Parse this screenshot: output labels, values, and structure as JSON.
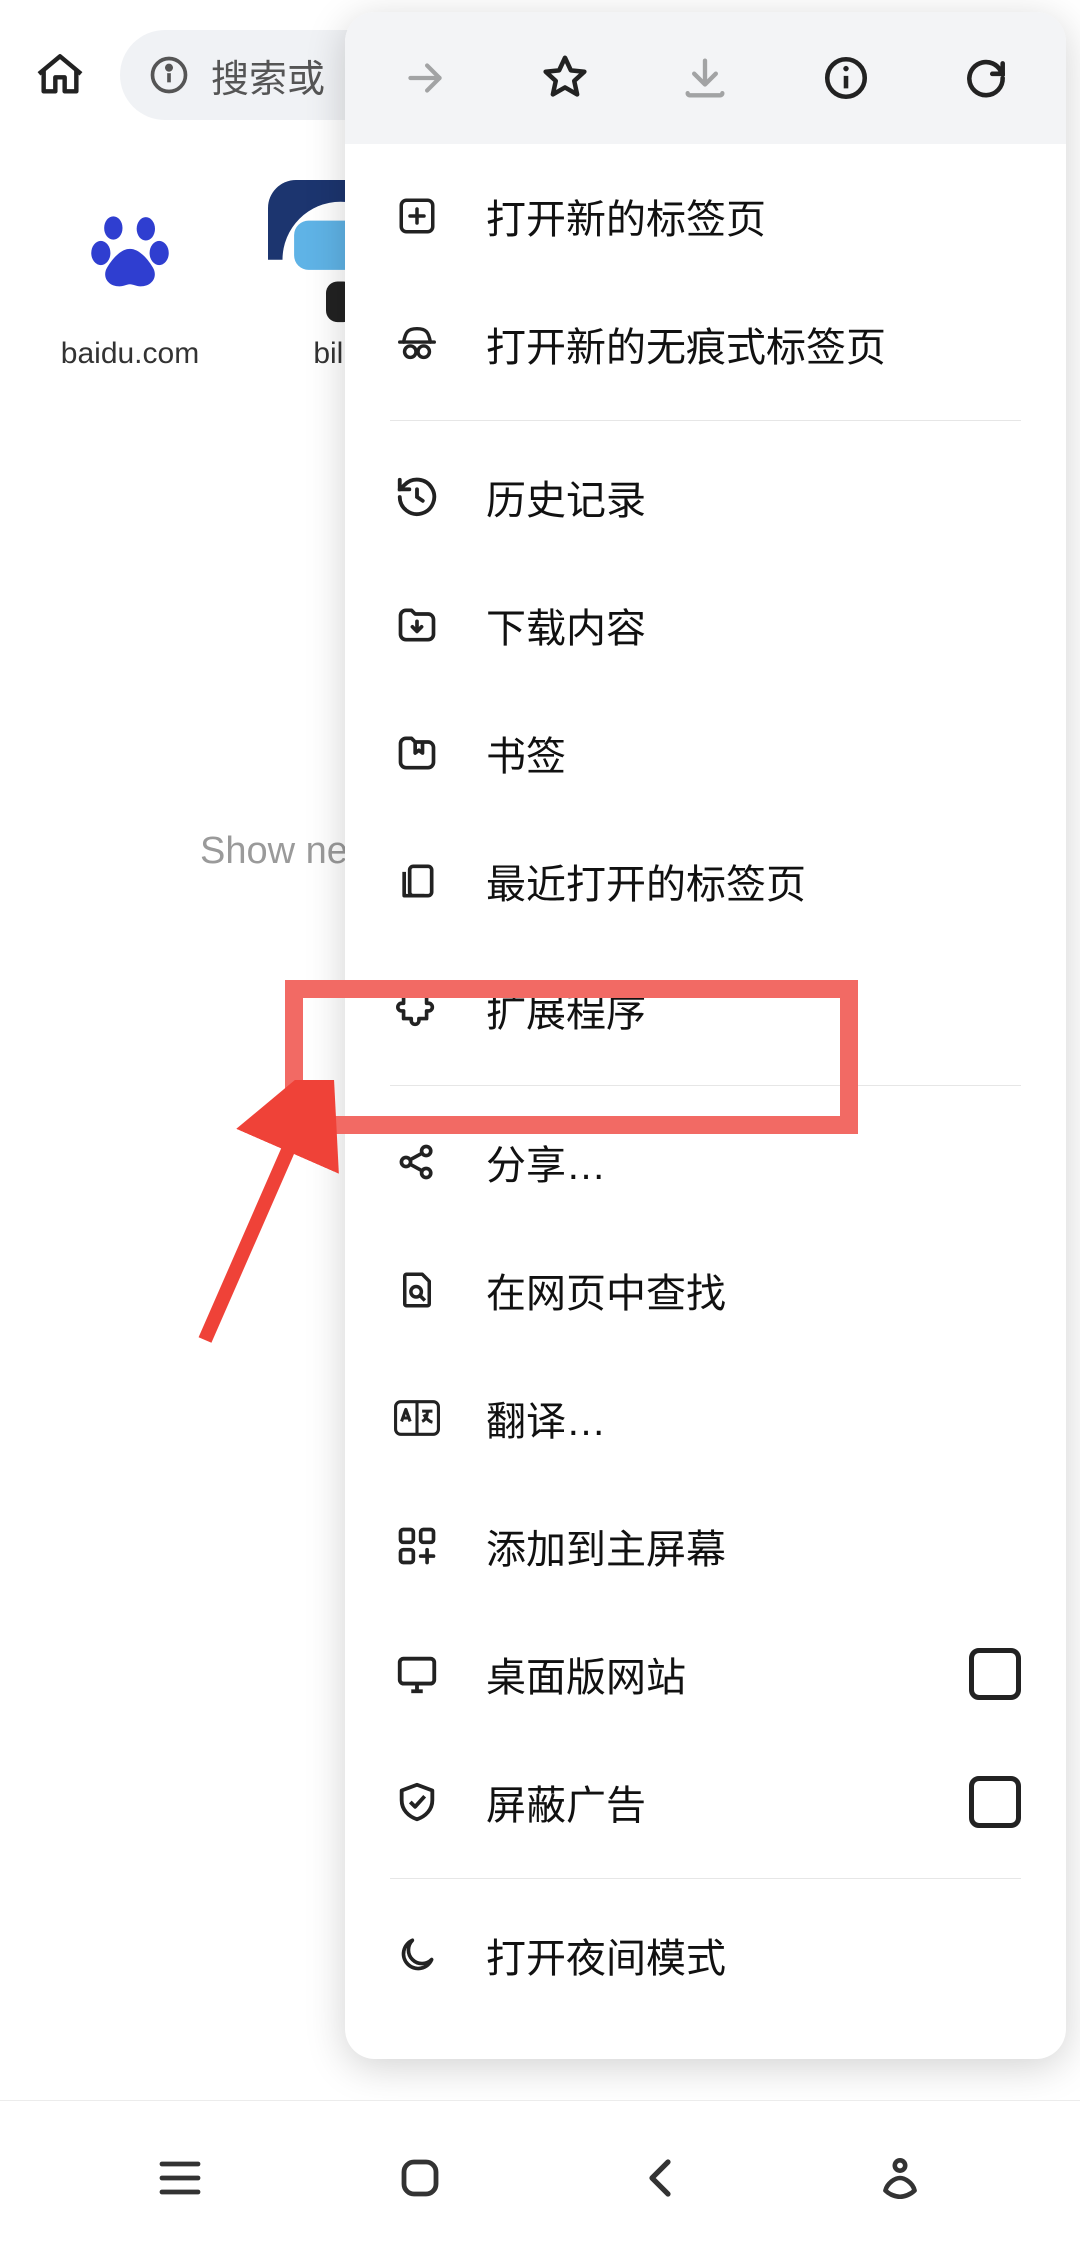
{
  "toolbar": {
    "url_placeholder": "搜索或"
  },
  "speed_dial": {
    "items": [
      {
        "label": "baidu.com"
      },
      {
        "label": "bilib"
      }
    ]
  },
  "background_text": "Show ne",
  "menu": {
    "sections": [
      [
        {
          "id": "new_tab",
          "label": "打开新的标签页"
        },
        {
          "id": "incognito_tab",
          "label": "打开新的无痕式标签页"
        }
      ],
      [
        {
          "id": "history",
          "label": "历史记录"
        },
        {
          "id": "downloads",
          "label": "下载内容"
        },
        {
          "id": "bookmarks",
          "label": "书签"
        },
        {
          "id": "recent_tabs",
          "label": "最近打开的标签页"
        },
        {
          "id": "extensions",
          "label": "扩展程序",
          "highlighted": true
        }
      ],
      [
        {
          "id": "share",
          "label": "分享…"
        },
        {
          "id": "find",
          "label": "在网页中查找"
        },
        {
          "id": "translate",
          "label": "翻译…"
        },
        {
          "id": "add_home",
          "label": "添加到主屏幕"
        },
        {
          "id": "desktop_site",
          "label": "桌面版网站",
          "checkbox": true,
          "checked": false
        },
        {
          "id": "block_ads",
          "label": "屏蔽广告",
          "checkbox": true,
          "checked": false
        }
      ],
      [
        {
          "id": "night_mode",
          "label": "打开夜间模式"
        }
      ]
    ]
  }
}
